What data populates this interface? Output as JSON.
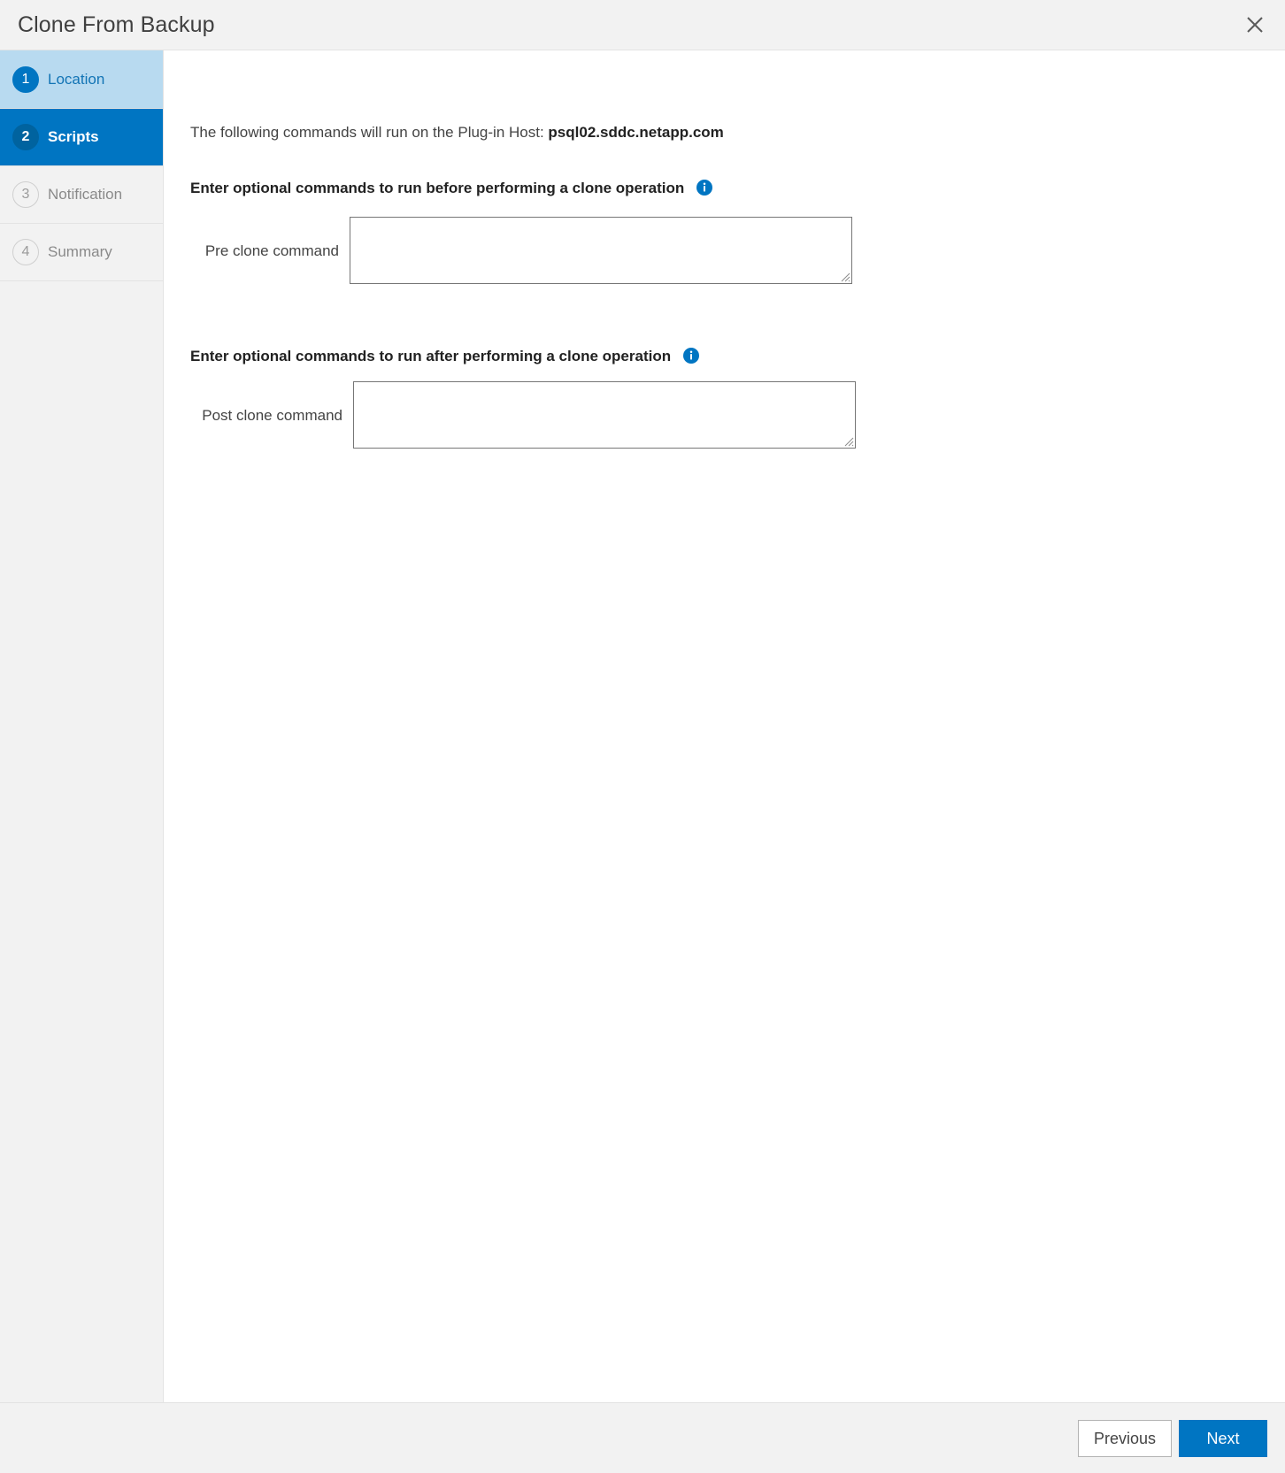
{
  "window": {
    "title": "Clone From Backup",
    "close_icon": "close-icon"
  },
  "wizard": {
    "steps": [
      {
        "number": "1",
        "label": "Location",
        "state": "done"
      },
      {
        "number": "2",
        "label": "Scripts",
        "state": "current"
      },
      {
        "number": "3",
        "label": "Notification",
        "state": "upcoming"
      },
      {
        "number": "4",
        "label": "Summary",
        "state": "upcoming"
      }
    ]
  },
  "main": {
    "intro_prefix": "The following commands will run on the Plug-in Host:",
    "plugin_host": "psql02.sddc.netapp.com",
    "pre": {
      "heading": "Enter optional commands to run before performing a clone operation",
      "info_icon": "info-icon",
      "label": "Pre clone command",
      "value": "",
      "placeholder": ""
    },
    "post": {
      "heading": "Enter optional commands to run after performing a clone operation",
      "info_icon": "info-icon",
      "label": "Post clone command",
      "value": "",
      "placeholder": ""
    }
  },
  "footer": {
    "previous_label": "Previous",
    "next_label": "Next"
  },
  "colors": {
    "accent": "#0075c2",
    "accent_dark": "#00639f",
    "step_done_bg": "#b8daf0",
    "chrome_bg": "#f2f2f2",
    "border": "#e3e3e3"
  }
}
